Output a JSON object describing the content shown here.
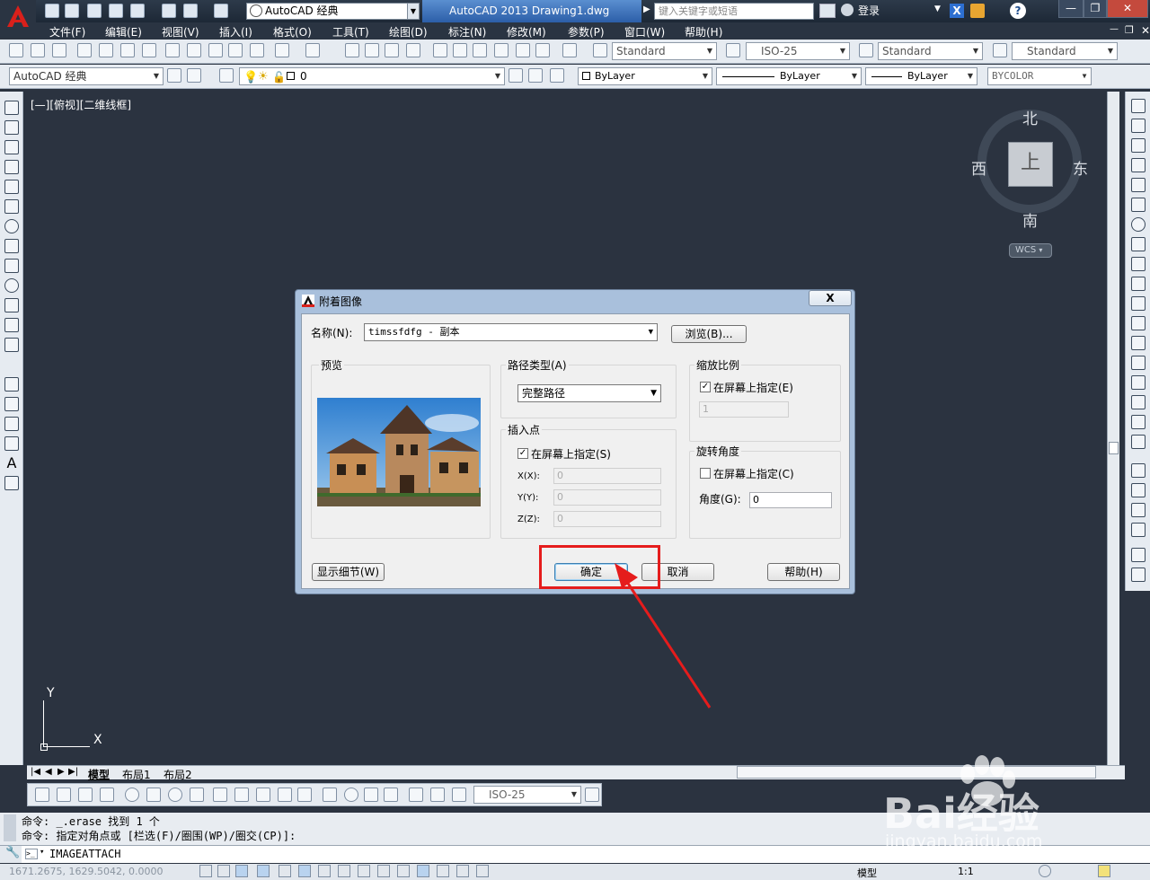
{
  "titlebar": {
    "workspace": "AutoCAD 经典",
    "doc_title": "AutoCAD 2013    Drawing1.dwg",
    "search_placeholder": "键入关键字或短语",
    "login": "登录",
    "help": "?"
  },
  "menu": [
    "文件(F)",
    "编辑(E)",
    "视图(V)",
    "插入(I)",
    "格式(O)",
    "工具(T)",
    "绘图(D)",
    "标注(N)",
    "修改(M)",
    "参数(P)",
    "窗口(W)",
    "帮助(H)"
  ],
  "toolbar1": {
    "text_style": "Standard",
    "dim_style": "ISO-25",
    "table_style": "Standard",
    "mleader_style": "Standard"
  },
  "toolbar2": {
    "workspace": "AutoCAD 经典",
    "layer": "0",
    "color": "ByLayer",
    "linetype": "ByLayer",
    "lineweight": "ByLayer",
    "plotstyle": "BYCOLOR"
  },
  "viewport": {
    "label": "[—][俯视][二维线框]",
    "compass": {
      "n": "北",
      "s": "南",
      "e": "东",
      "w": "西",
      "top": "上"
    },
    "wcs": "WCS",
    "ucs_x": "X",
    "ucs_y": "Y"
  },
  "dialog": {
    "title": "附着图像",
    "close": "X",
    "name_label": "名称(N):",
    "name_value": "timssfdfg - 副本",
    "browse": "浏览(B)...",
    "preview_label": "预览",
    "path_type_label": "路径类型(A)",
    "path_type_value": "完整路径",
    "insert_label": "插入点",
    "insert_onscreen": "在屏幕上指定(S)",
    "x_label": "X(X):",
    "y_label": "Y(Y):",
    "z_label": "Z(Z):",
    "x_value": "0",
    "y_value": "0",
    "z_value": "0",
    "scale_label": "缩放比例",
    "scale_onscreen": "在屏幕上指定(E)",
    "scale_value": "1",
    "rotation_label": "旋转角度",
    "rotation_onscreen": "在屏幕上指定(C)",
    "angle_label": "角度(G):",
    "angle_value": "0",
    "details": "显示细节(W)",
    "ok": "确定",
    "cancel": "取消",
    "help": "帮助(H)",
    "insert_checked": true,
    "scale_checked": true,
    "rotation_checked": false
  },
  "tabs": [
    "模型",
    "布局1",
    "布局2"
  ],
  "dimstyle_bottom": "ISO-25",
  "command": {
    "history1": "命令: _.erase 找到 1 个",
    "history2": "命令: 指定对角点或 [栏选(F)/圈围(WP)/圈交(CP)]:",
    "current": "IMAGEATTACH"
  },
  "status": {
    "coords": "1671.2675, 1629.5042, 0.0000",
    "model": "模型",
    "scale": "1:1"
  },
  "watermark": {
    "brand": "Bai经验",
    "url": "jingyan.baidu.com"
  },
  "colors": {
    "accent_red": "#e51c1c",
    "canvas": "#2b3340",
    "title_blue": "#2c5ea8"
  }
}
